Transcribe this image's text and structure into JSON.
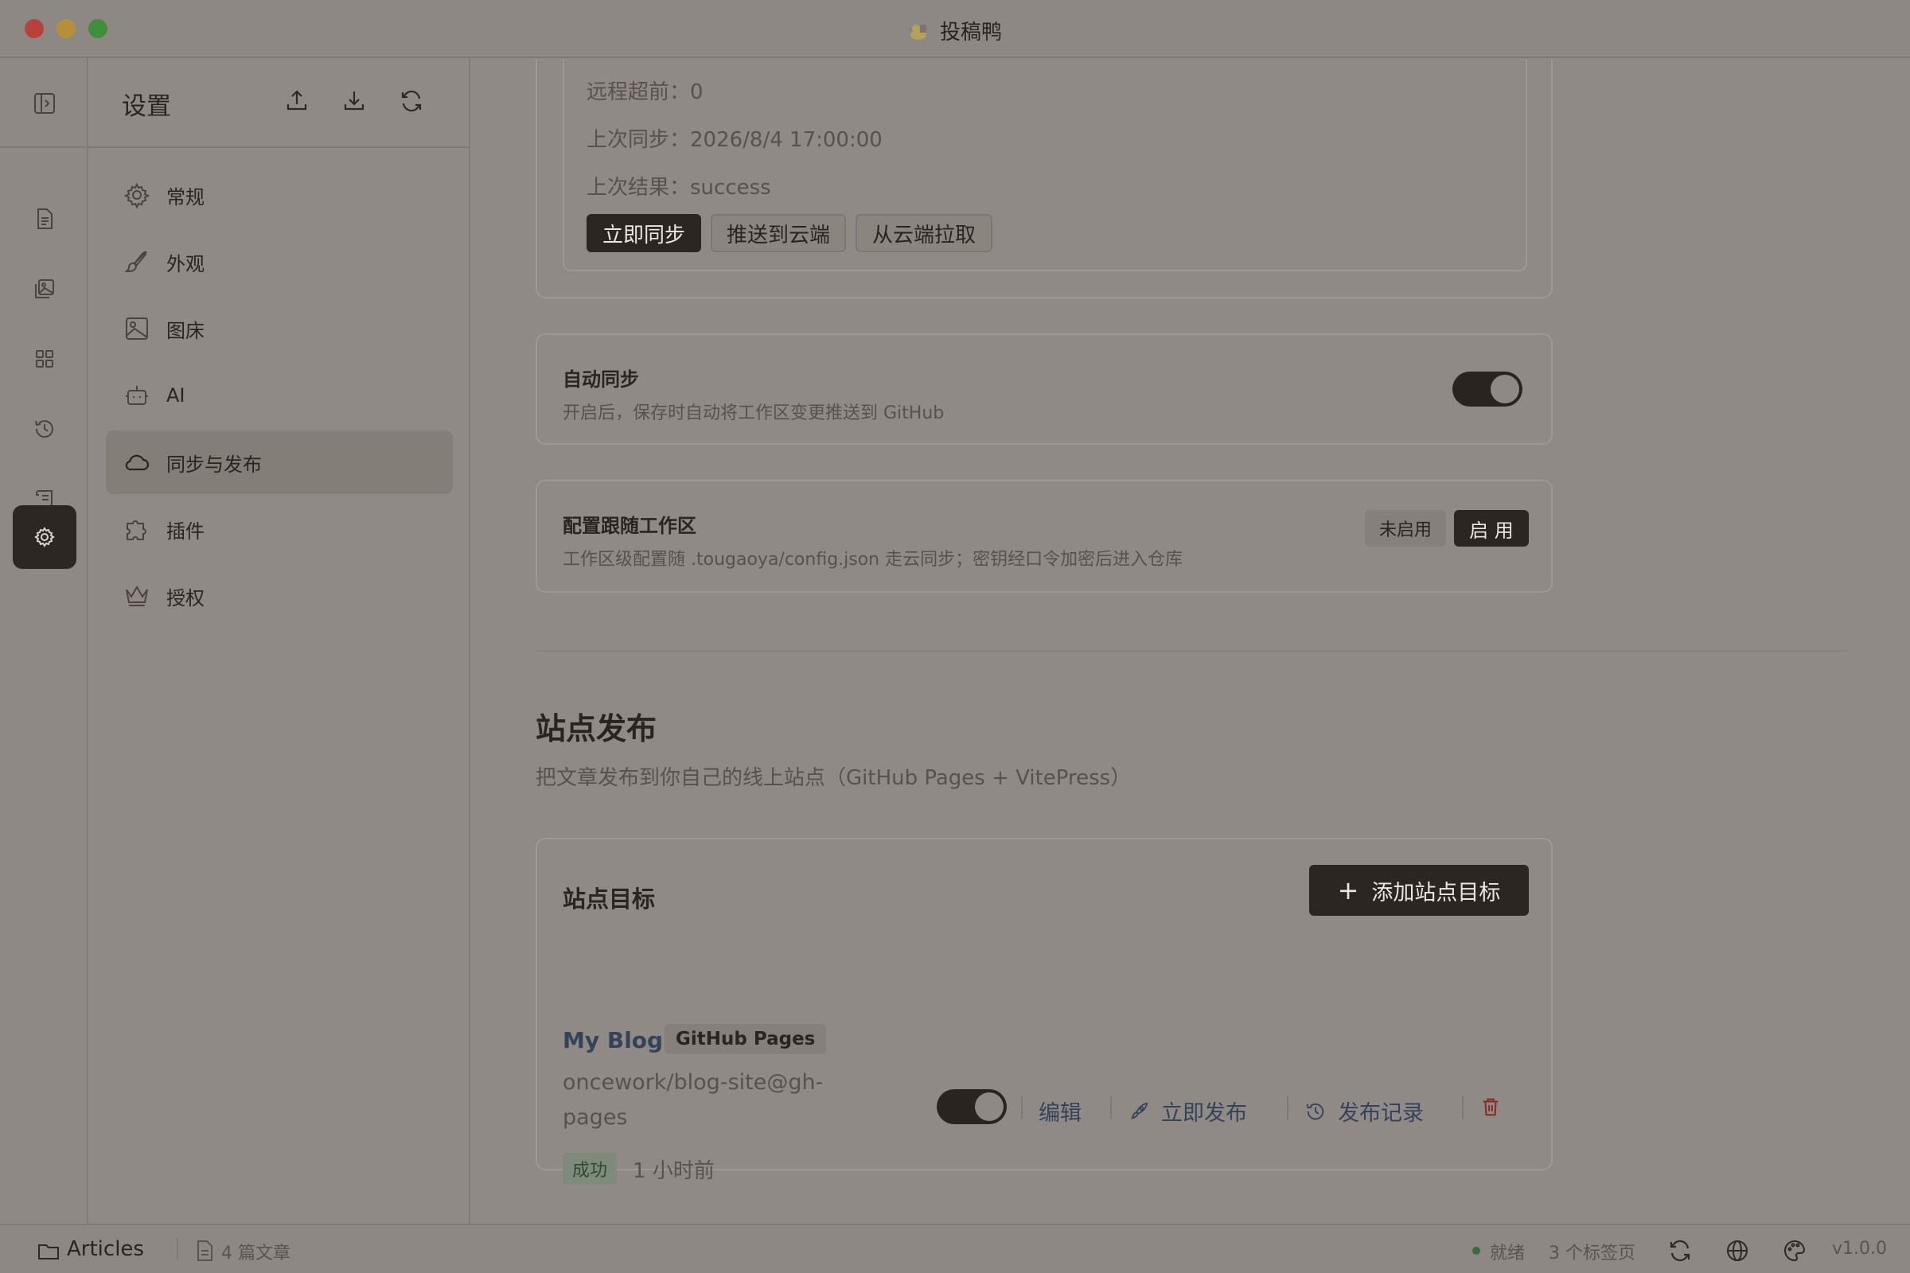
{
  "window": {
    "title": "投稿鸭"
  },
  "sidebar": {
    "title": "设置",
    "items": [
      {
        "label": "常规",
        "icon": "gear-icon"
      },
      {
        "label": "外观",
        "icon": "brush-icon"
      },
      {
        "label": "图床",
        "icon": "image-icon"
      },
      {
        "label": "AI",
        "icon": "robot-icon"
      },
      {
        "label": "同步与发布",
        "icon": "cloud-icon",
        "active": true
      },
      {
        "label": "插件",
        "icon": "puzzle-icon"
      },
      {
        "label": "授权",
        "icon": "crown-icon"
      }
    ]
  },
  "sync": {
    "remote_ahead": "远程超前：0",
    "last_sync": "上次同步：2026/8/4 17:00:00",
    "last_result": "上次结果：success",
    "btn_sync_now": "立即同步",
    "btn_push": "推送到云端",
    "btn_pull": "从云端拉取"
  },
  "auto_sync": {
    "title": "自动同步",
    "desc": "开启后，保存时自动将工作区变更推送到 GitHub",
    "enabled": true
  },
  "config_follow": {
    "title": "配置跟随工作区",
    "desc": "工作区级配置随 .tougaoya/config.json 走云同步；密钥经口令加密后进入仓库",
    "opt_off": "未启用",
    "opt_on": "启 用"
  },
  "site_publish": {
    "title": "站点发布",
    "desc": "把文章发布到你自己的线上站点（GitHub Pages + VitePress）",
    "targets_title": "站点目标",
    "add_button": "添加站点目标",
    "target": {
      "name": "My Blog",
      "type_badge": "GitHub Pages",
      "repo_line1": "oncework/blog-site@gh-",
      "repo_line2": "pages",
      "status": "成功",
      "time": "1 小时前",
      "enabled": true,
      "edit": "编辑",
      "publish_now": "立即发布",
      "history": "发布记录"
    }
  },
  "statusbar": {
    "folder": "Articles",
    "count": "4 篇文章",
    "state": "就绪",
    "tabs": "3 个标签页",
    "version": "v1.0.0"
  },
  "colors": {
    "accent_dark": "#2c2623",
    "link": "#34425a",
    "danger": "#8a2a24",
    "success_bg": "#7f8a7d"
  }
}
